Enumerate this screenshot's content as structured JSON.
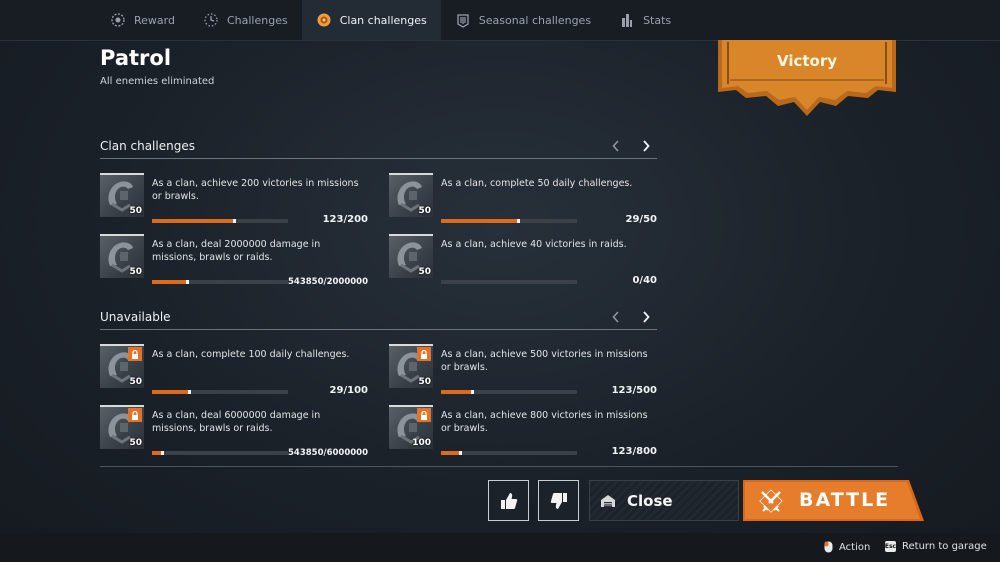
{
  "nav": {
    "tabs": [
      {
        "label": "Reward",
        "icon": "reward-icon",
        "active": false
      },
      {
        "label": "Challenges",
        "icon": "challenges-icon",
        "active": false
      },
      {
        "label": "Clan challenges",
        "icon": "clan-challenges-icon",
        "active": true
      },
      {
        "label": "Seasonal challenges",
        "icon": "seasonal-challenges-icon",
        "active": false
      },
      {
        "label": "Stats",
        "icon": "stats-icon",
        "active": false
      }
    ]
  },
  "header": {
    "title": "Patrol",
    "subtitle": "All enemies eliminated",
    "result": "Victory"
  },
  "clan_challenges": {
    "heading": "Clan challenges",
    "items": [
      {
        "level": "50",
        "desc": "As a clan, achieve 200 victories in missions or brawls.",
        "progress": "123/200",
        "fraction": 0.615,
        "locked": false
      },
      {
        "level": "50",
        "desc": "As a clan, complete 50 daily challenges.",
        "progress": "29/50",
        "fraction": 0.58,
        "locked": false
      },
      {
        "level": "50",
        "desc": "As a clan, deal 2000000 damage in missions, brawls or raids.",
        "progress": "543850/2000000",
        "fraction": 0.272,
        "locked": false
      },
      {
        "level": "50",
        "desc": "As a clan, achieve 40 victories in raids.",
        "progress": "0/40",
        "fraction": 0.0,
        "locked": false
      }
    ]
  },
  "unavailable": {
    "heading": "Unavailable",
    "items": [
      {
        "level": "50",
        "desc": "As a clan, complete 100 daily challenges.",
        "progress": "29/100",
        "fraction": 0.29,
        "locked": true
      },
      {
        "level": "50",
        "desc": "As a clan, achieve 500 victories in missions or brawls.",
        "progress": "123/500",
        "fraction": 0.246,
        "locked": true
      },
      {
        "level": "50",
        "desc": "As a clan, deal 6000000 damage in missions, brawls or raids.",
        "progress": "543850/6000000",
        "fraction": 0.091,
        "locked": true
      },
      {
        "level": "100",
        "desc": "As a clan, achieve 800 victories in missions or brawls.",
        "progress": "123/800",
        "fraction": 0.154,
        "locked": true
      }
    ]
  },
  "actions": {
    "like_icon": "thumbs-up-icon",
    "dislike_icon": "thumbs-down-icon",
    "close_label": "Close",
    "battle_label": "BATTLE"
  },
  "footer": {
    "action_label": "Action",
    "return_key": "Esc",
    "return_label": "Return to garage"
  },
  "colors": {
    "accent": "#e06a1c",
    "banner": "#c97a24",
    "battle": "#e07a24"
  }
}
